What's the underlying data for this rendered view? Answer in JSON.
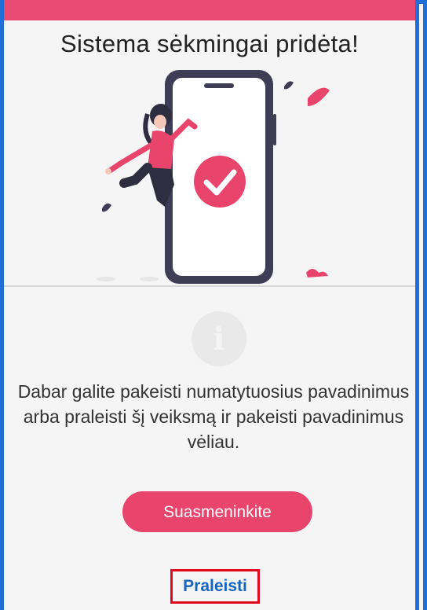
{
  "dialog": {
    "title": "Sistema sėkmingai pridėta!",
    "message": "Dabar galite pakeisti numatytuosius pavadinimus arba praleisti šį veiksmą ir pakeisti pavadinimus vėliau.",
    "personalize_label": "Suasmeninkite",
    "skip_label": "Praleisti"
  },
  "icons": {
    "illustration": "success-phone-illustration",
    "info": "info-icon"
  },
  "colors": {
    "accent": "#e9446c",
    "link": "#1565c0",
    "highlight_border": "#e0081f",
    "frame_border": "#1f6fd6"
  }
}
